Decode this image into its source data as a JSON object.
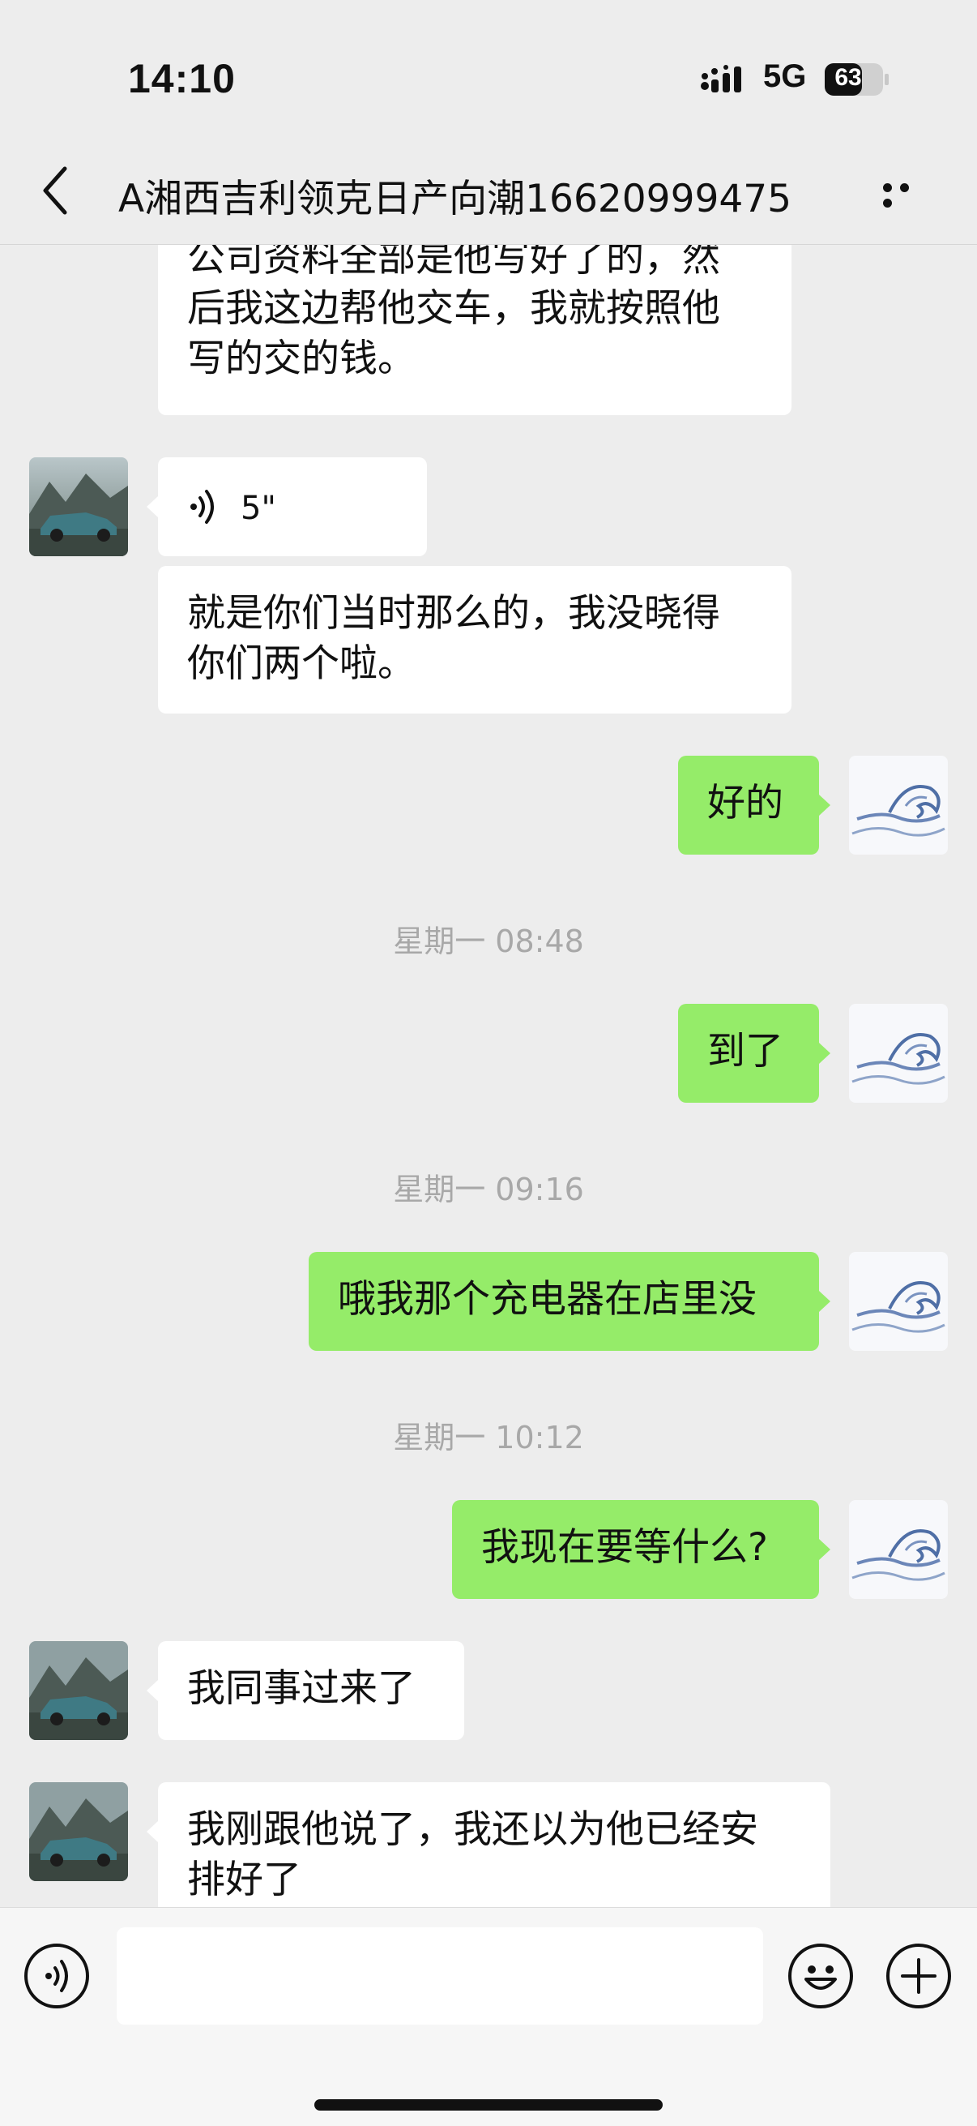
{
  "status_bar": {
    "time": "14:10",
    "network": "5G",
    "battery": "63"
  },
  "nav": {
    "title": "A湘西吉利领克日产向潮16620999475"
  },
  "messages": {
    "m1_line1": "公司资料全部是他写好了的，然",
    "m1_line2": "后我这边帮他交车，我就按照他",
    "m1_line3": "写的交的钱。",
    "m2_voice_duration": "5\"",
    "m3_line1": "就是你们当时那么的，我没晓得",
    "m3_line2": "你们两个啦。",
    "m4": "好的",
    "t1": "星期一 08:48",
    "m5": "到了",
    "t2": "星期一 09:16",
    "m6": "哦我那个充电器在店里没",
    "t3": "星期一 10:12",
    "m7": "我现在要等什么?",
    "m8": "我同事过来了",
    "m9_line1": "我刚跟他说了，我还以为他已经安",
    "m9_line2": "排好了"
  },
  "colors": {
    "background": "#ededed",
    "outgoing_bubble": "#95ec69",
    "incoming_bubble": "#ffffff"
  },
  "icons": [
    "back-icon",
    "more-icon",
    "voice-icon",
    "emoji-icon",
    "plus-icon"
  ]
}
